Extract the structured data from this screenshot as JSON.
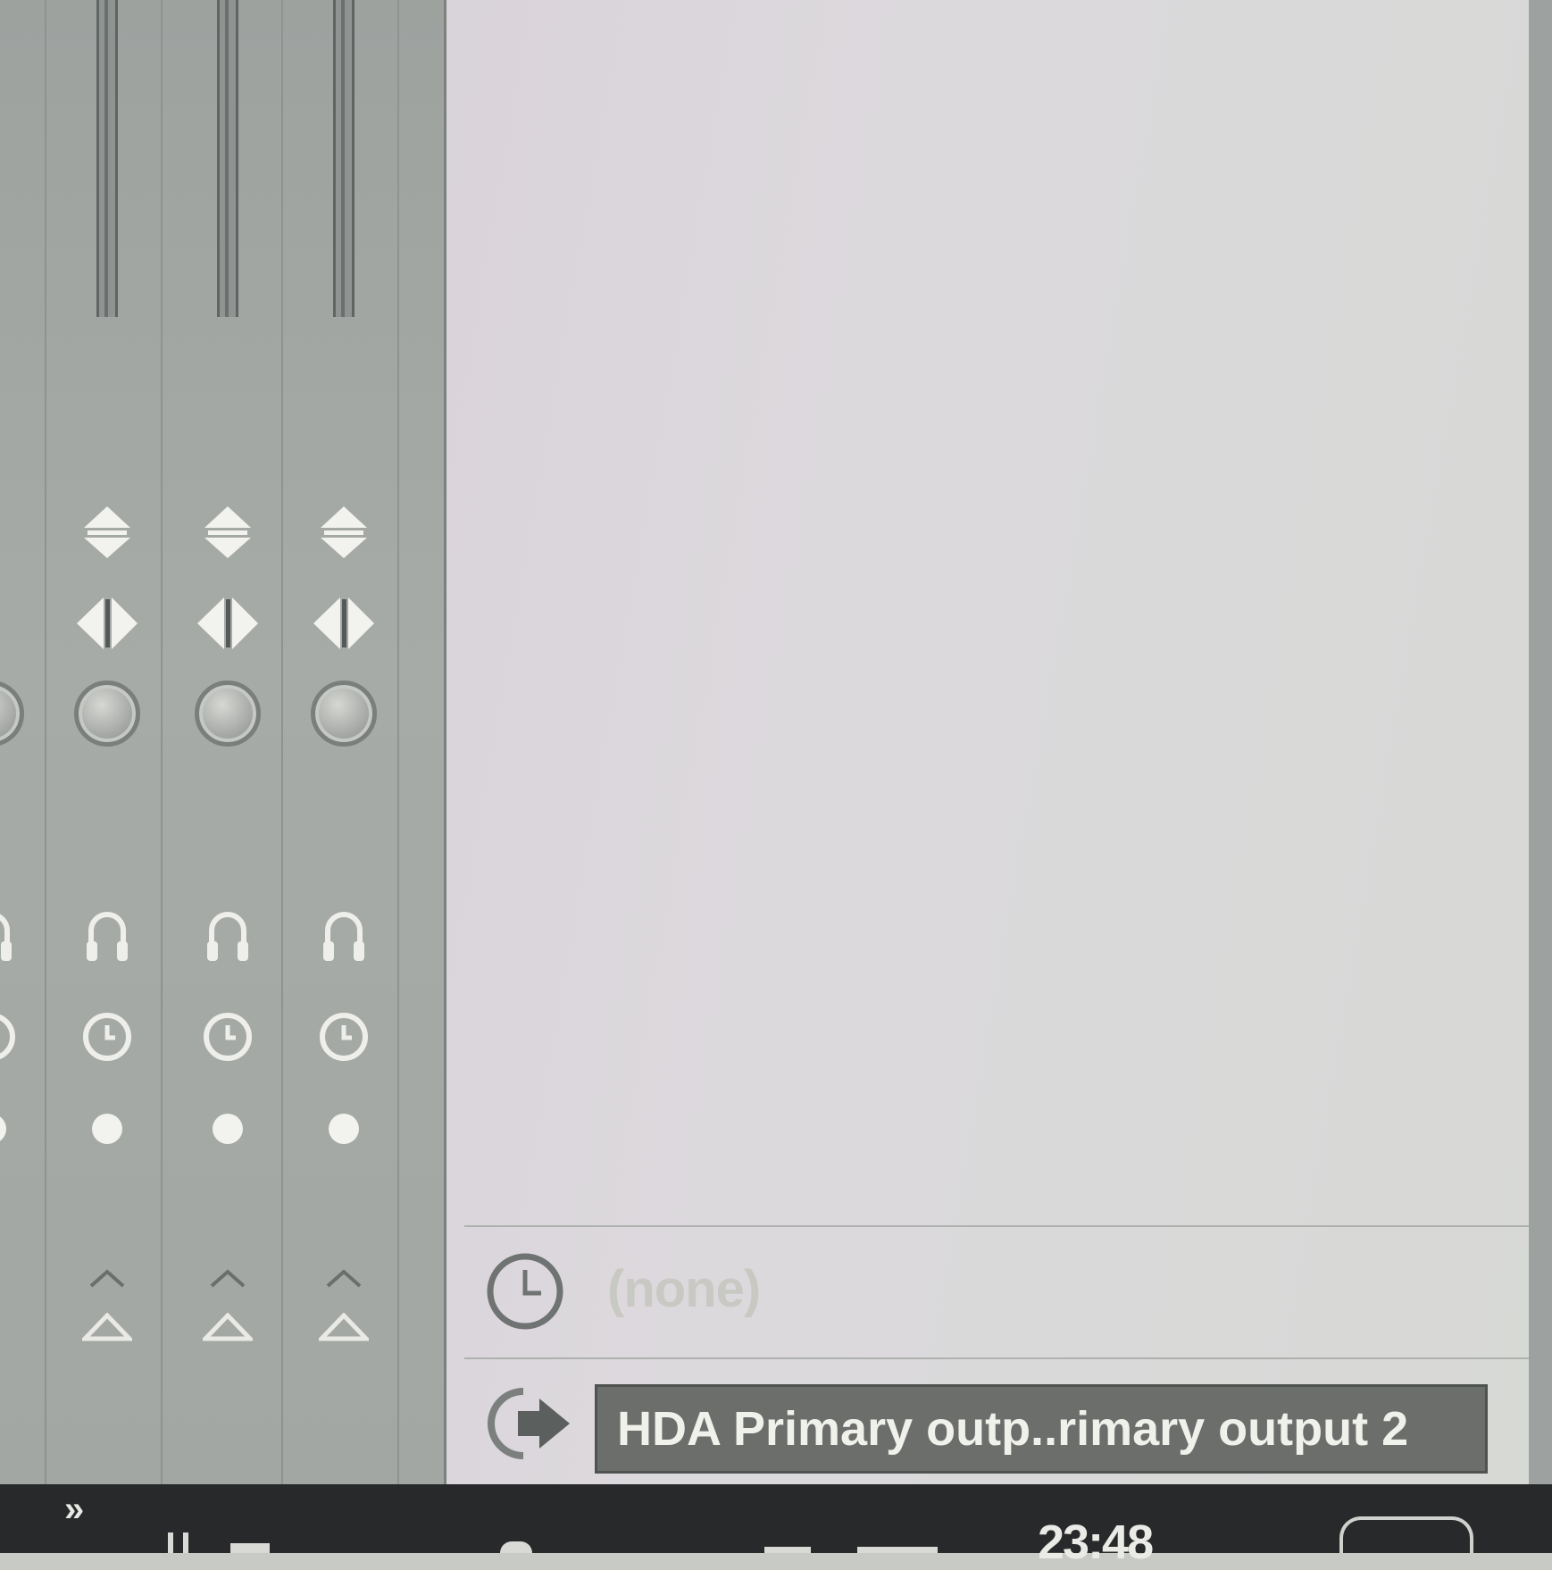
{
  "mixer": {
    "strips": [
      {
        "id": "strip-1"
      },
      {
        "id": "strip-2"
      },
      {
        "id": "strip-3"
      },
      {
        "id": "strip-4"
      }
    ]
  },
  "sources": {
    "input_label": "(none)",
    "output_label": "HDA Primary outp..rimary output 2"
  },
  "taskbar": {
    "overflow_glyph": "»",
    "time": "23:48"
  },
  "colors": {
    "panel_bg": "#dcd9dd",
    "mixer_bg": "#a3a7a4",
    "output_box_bg": "#6b6e6b",
    "taskbar_bg": "#27292a"
  }
}
